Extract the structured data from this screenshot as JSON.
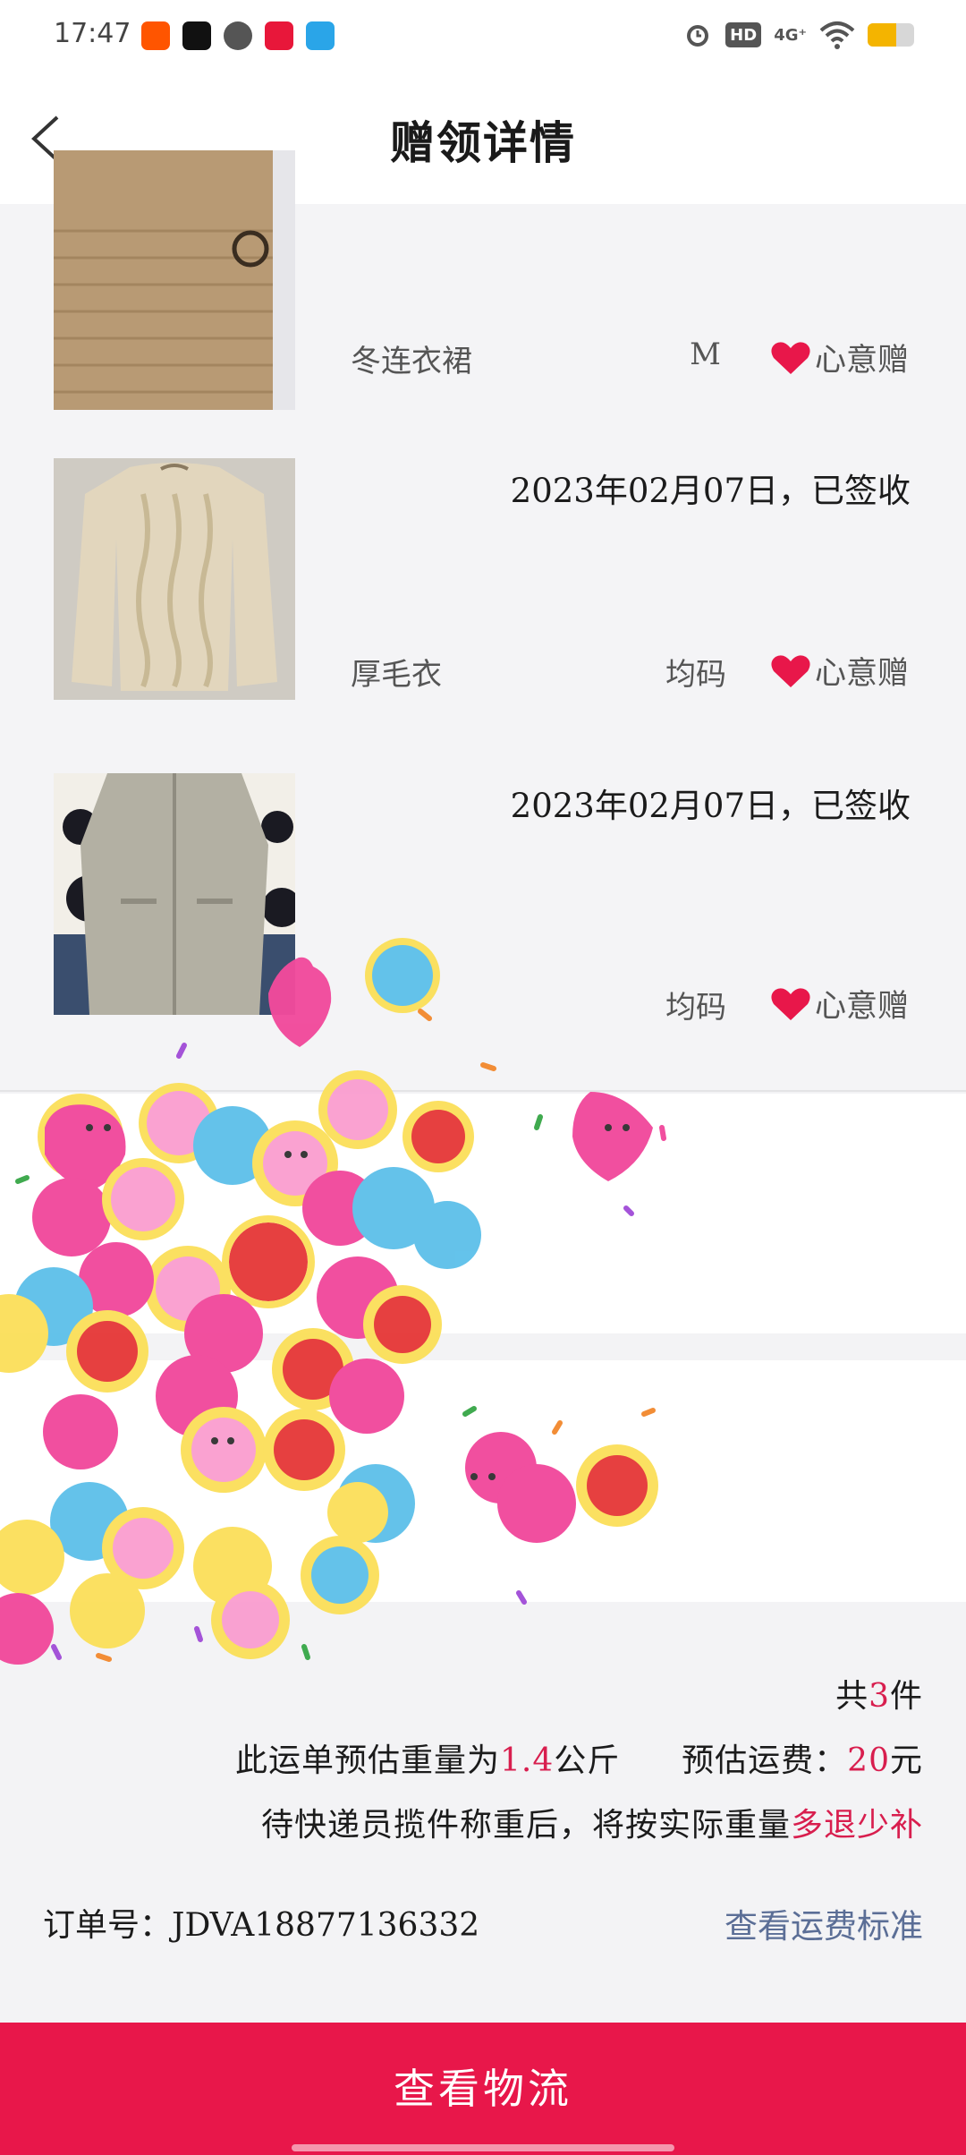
{
  "status": {
    "time": "17:47",
    "network": "4G⁺",
    "hd": "HD"
  },
  "nav": {
    "title": "赠领详情"
  },
  "items": [
    {
      "date": "",
      "name": "冬连衣裙",
      "size": "M",
      "type": "心意赠"
    },
    {
      "date": "2023年02月07日，已签收",
      "name": "厚毛衣",
      "size": "均码",
      "type": "心意赠"
    },
    {
      "date": "2023年02月07日，已签收",
      "name": "",
      "size": "均码",
      "type": "心意赠"
    }
  ],
  "summary": {
    "count_prefix": "共",
    "count": "3",
    "count_suffix": "件",
    "weight_prefix": "此运单预估重量为",
    "weight": "1.4",
    "weight_unit": "公斤",
    "fee_prefix": "预估运费：",
    "fee": "20",
    "fee_unit": "元",
    "note_prefix": "待快递员揽件称重后，将按实际重量",
    "note_highlight": "多退少补",
    "order_label": "订单号：",
    "order_no": "JDVA18877136332",
    "fee_link": "查看运费标准"
  },
  "button": {
    "label": "查看物流"
  },
  "colors": {
    "accent": "#e8174a",
    "highlight": "#d81e4e",
    "link": "#5b6e96"
  }
}
